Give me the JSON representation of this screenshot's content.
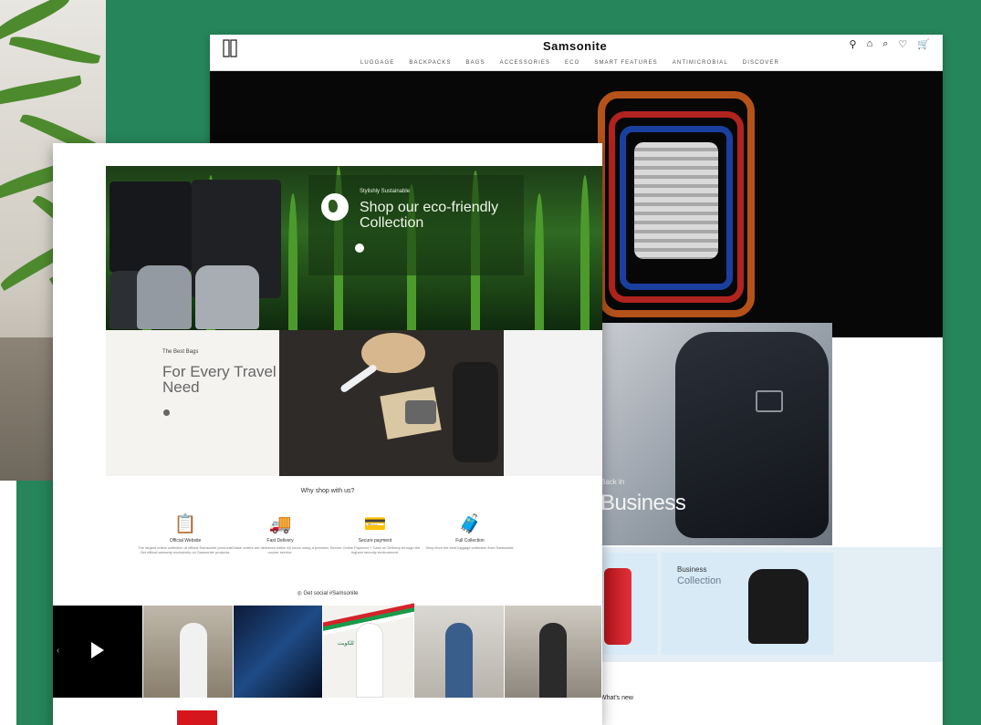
{
  "colors": {
    "background": "#26855a",
    "accent": "#2a6fb4"
  },
  "back_page": {
    "brand": "Samsonite",
    "header_icons": [
      "user-icon",
      "store-icon",
      "search-icon",
      "heart-icon",
      "cart-icon"
    ],
    "nav": [
      "LUGGAGE",
      "BACKPACKS",
      "BAGS",
      "ACCESSORIES",
      "ECO",
      "SMART FEATURES",
      "ANTIMICROBIAL",
      "DISCOVER"
    ],
    "business_tag": "Back in",
    "business_title": "Business",
    "business_card": {
      "title": "Business",
      "subtitle": "Collection"
    },
    "whats_new": "What's new"
  },
  "front_page": {
    "eco": {
      "tag": "Stylishly Sustainable",
      "title": "Shop our eco-friendly Collection"
    },
    "travel": {
      "label": "The Best Bags",
      "title": "For Every Travel Need"
    },
    "why_title": "Why shop with us?",
    "features": [
      {
        "icon": "clipboard-icon",
        "glyph": "📋",
        "title": "Official Website",
        "desc": "The largest online collection of official Samsonite products. Get official warranty exclusively on Samsonite products."
      },
      {
        "icon": "delivery-car-icon",
        "glyph": "🚚",
        "title": "Fast Delivery",
        "desc": "Online orders are delivered within 48 hours using a premium courier service."
      },
      {
        "icon": "secure-payment-icon",
        "glyph": "💳",
        "title": "Secure payment",
        "desc": "Secure Online Payment + Cash on Delivery through the highest security environment."
      },
      {
        "icon": "luggage-icon",
        "glyph": "🧳",
        "title": "Full Collection",
        "desc": "Shop from the best luggage collection from Samsonite."
      }
    ],
    "social": "Get social #Samsonite",
    "gallery_arabic": "شكرا للكويت"
  }
}
